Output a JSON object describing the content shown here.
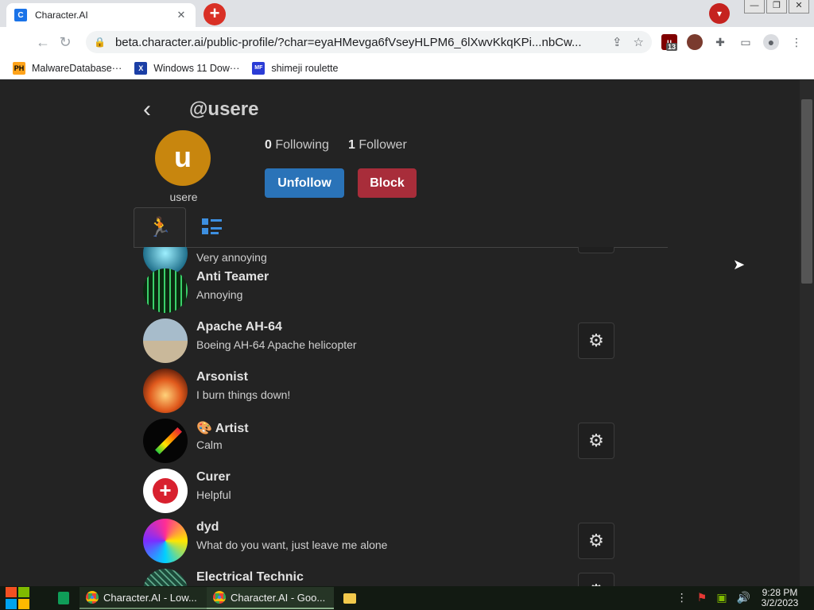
{
  "browser": {
    "tab_title": "Character.AI",
    "tab_close": "✕",
    "new_tab": "+",
    "url": "beta.character.ai/public-profile/?char=eyaHMevga6fVseyHLPM6_6lXwvKkqKPi...nbCw...",
    "window_buttons": [
      "—",
      "❐",
      "✕"
    ],
    "bookmarks": [
      {
        "label": "MalwareDatabase···",
        "icon": "ph"
      },
      {
        "label": "Windows 11 Dow···",
        "icon": "win"
      },
      {
        "label": "shimeji roulette",
        "icon": "shim"
      }
    ],
    "ublock_count": "13"
  },
  "profile": {
    "handle": "@usere",
    "avatar_letter": "u",
    "username": "usere",
    "following_count": "0",
    "following_label": "Following",
    "followers_count": "1",
    "followers_label": "Follower",
    "unfollow_label": "Unfollow",
    "block_label": "Block",
    "colors": {
      "avatar": "#c8860e",
      "unfollow": "#2a73b8",
      "block": "#a82d3a"
    }
  },
  "characters": [
    {
      "name": "",
      "desc": "Very annoying",
      "has_settings": true,
      "pic": "crystal"
    },
    {
      "name": "Anti Teamer",
      "desc": "Annoying",
      "has_settings": false,
      "pic": "matrix"
    },
    {
      "name": "Apache AH-64",
      "desc": "Boeing AH-64 Apache helicopter",
      "has_settings": true,
      "pic": "heli"
    },
    {
      "name": "Arsonist",
      "desc": "I burn things down!",
      "has_settings": false,
      "pic": "fire"
    },
    {
      "name": "🎨 Artist",
      "desc": "Calm",
      "has_settings": true,
      "pic": "brush"
    },
    {
      "name": "Curer",
      "desc": "Helpful",
      "has_settings": false,
      "pic": "cross"
    },
    {
      "name": "dyd",
      "desc": "What do you want, just leave me alone",
      "has_settings": true,
      "pic": "swirl"
    },
    {
      "name": "Electrical Technic",
      "desc": "",
      "has_settings": true,
      "pic": "circuit"
    }
  ],
  "taskbar": {
    "apps": [
      "Character.AI - Low...",
      "Character.AI - Goo..."
    ],
    "time": "9:28 PM",
    "date": "3/2/2023"
  }
}
